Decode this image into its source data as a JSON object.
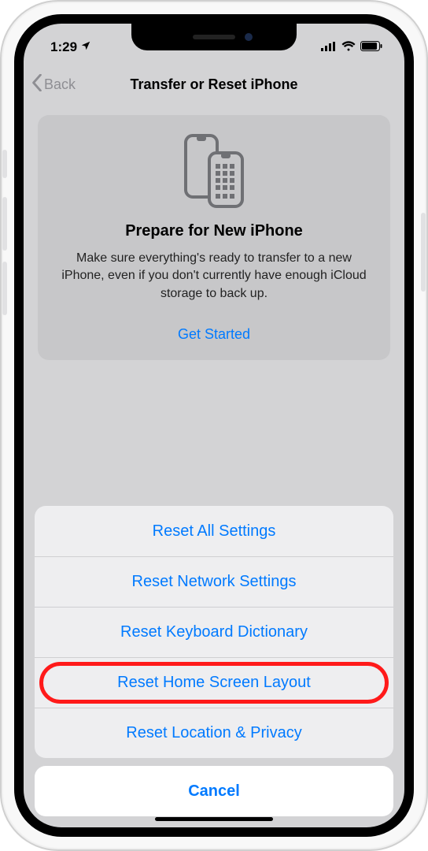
{
  "status": {
    "time": "1:29",
    "location_icon": "location-arrow",
    "signal": "signal-4",
    "wifi": "wifi",
    "battery": "battery"
  },
  "nav": {
    "back_label": "Back",
    "title": "Transfer or Reset iPhone"
  },
  "card": {
    "title": "Prepare for New iPhone",
    "description": "Make sure everything's ready to transfer to a new iPhone, even if you don't currently have enough iCloud storage to back up.",
    "cta": "Get Started"
  },
  "sheet": {
    "items": [
      "Reset All Settings",
      "Reset Network Settings",
      "Reset Keyboard Dictionary",
      "Reset Home Screen Layout",
      "Reset Location & Privacy"
    ],
    "highlighted_index": 3,
    "cancel": "Cancel"
  }
}
